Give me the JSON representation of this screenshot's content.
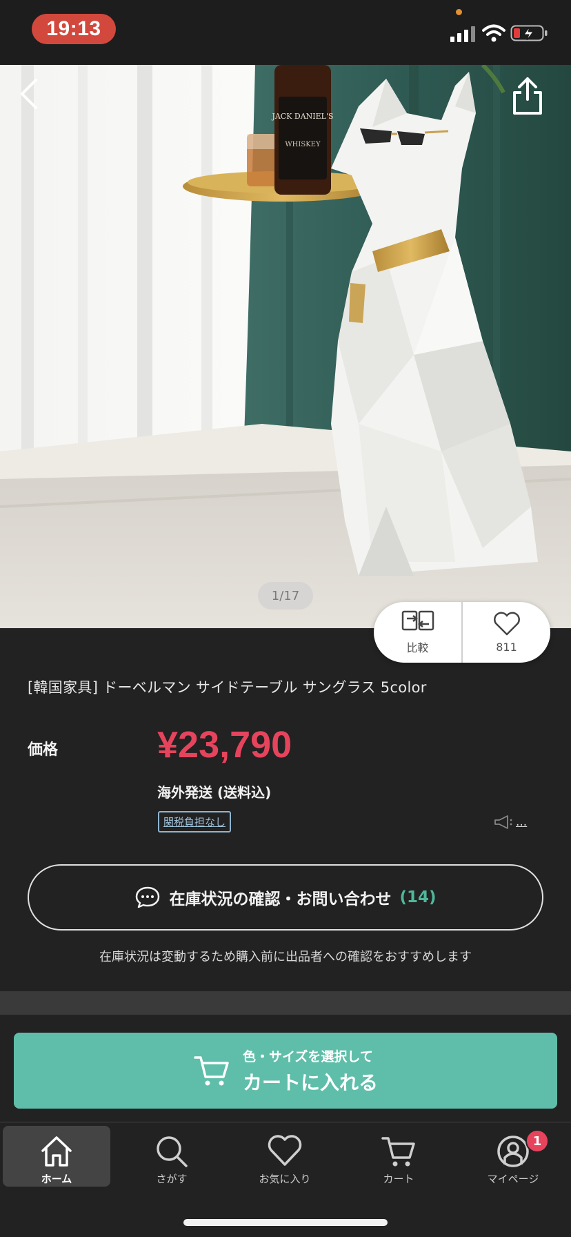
{
  "status_bar": {
    "time": "19:13",
    "icons": [
      "signal-icon",
      "wifi-icon",
      "battery-charging-icon"
    ]
  },
  "gallery": {
    "indicator": "1/17",
    "bottle_label": "JACK DANIEL'S",
    "bottle_label_2": "WHISKEY"
  },
  "actions": {
    "compare_label": "比較",
    "favorite_count": "811"
  },
  "product": {
    "title": "[韓国家具] ドーベルマン  サイドテーブル サングラス 5color",
    "price_label": "価格",
    "price": "¥23,790",
    "shipping": "海外発送 (送料込)",
    "tax_badge": "関税負担なし",
    "report_dots": "..."
  },
  "inquiry": {
    "label": "在庫状況の確認・お問い合わせ",
    "count": "(14)"
  },
  "notice": "在庫状況は変動するため購入前に出品者への確認をおすすめします",
  "cart": {
    "sub_label": "色・サイズを選択して",
    "main_label": "カートに入れる"
  },
  "tabs": [
    {
      "label": "ホーム",
      "icon": "home-icon"
    },
    {
      "label": "さがす",
      "icon": "search-icon"
    },
    {
      "label": "お気に入り",
      "icon": "heart-icon"
    },
    {
      "label": "カート",
      "icon": "cart-icon"
    },
    {
      "label": "マイページ",
      "icon": "profile-icon"
    }
  ],
  "mypage_badge": "1",
  "colors": {
    "price": "#e6445d",
    "accent": "#5fbea9",
    "background": "#222222",
    "time_pill": "#d2483d"
  }
}
